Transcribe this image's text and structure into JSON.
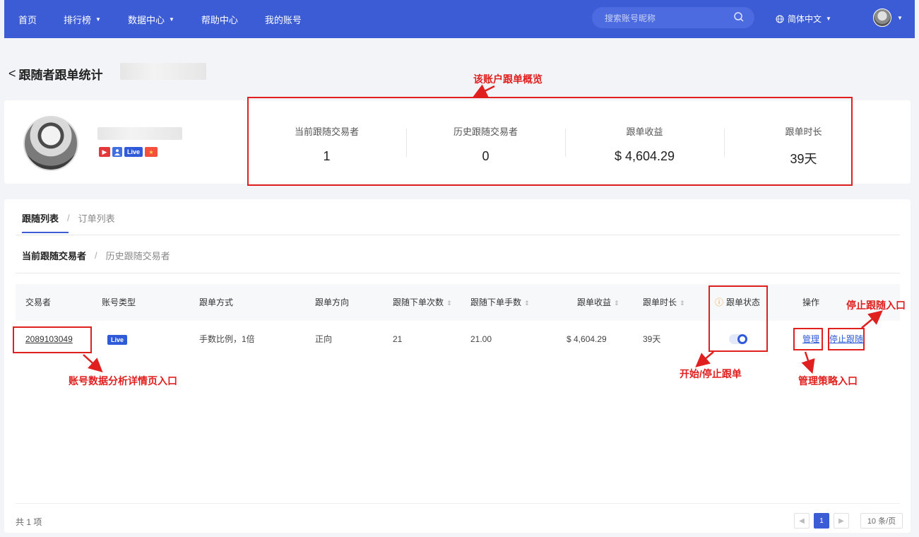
{
  "nav": {
    "items": [
      {
        "label": "首页",
        "caret": ""
      },
      {
        "label": "排行榜",
        "caret": "▼"
      },
      {
        "label": "数据中心",
        "caret": "▼"
      },
      {
        "label": "帮助中心",
        "caret": ""
      },
      {
        "label": "我的账号",
        "caret": ""
      }
    ],
    "search_placeholder": "搜索账号昵称",
    "language": "简体中文",
    "caret": "▼"
  },
  "page": {
    "back_symbol": "<",
    "title": "跟随者跟单统计"
  },
  "profile": {
    "badges": {
      "live": "Live"
    }
  },
  "stats": [
    {
      "label": "当前跟随交易者",
      "value": "1"
    },
    {
      "label": "历史跟随交易者",
      "value": "0"
    },
    {
      "label": "跟单收益",
      "value": "$ 4,604.29"
    },
    {
      "label": "跟单时长",
      "value": "39天"
    }
  ],
  "tabs": {
    "active": "跟随列表",
    "separator": "/",
    "inactive": "订单列表"
  },
  "subtabs": {
    "active": "当前跟随交易者",
    "separator": "/",
    "inactive": "历史跟随交易者"
  },
  "table": {
    "headers": [
      "交易者",
      "账号类型",
      "跟单方式",
      "跟单方向",
      "跟随下单次数",
      "跟随下单手数",
      "跟单收益",
      "跟单时长",
      "跟单状态",
      "操作"
    ],
    "sort_symbol": "⇕",
    "rows": [
      {
        "trader": "2089103049",
        "account_type": "Live",
        "copy_mode": "手数比例，1倍",
        "direction": "正向",
        "order_count": "21",
        "lots": "21.00",
        "profit": "$ 4,604.29",
        "duration": "39天",
        "status_on": true,
        "manage": "管理",
        "stop": "停止跟随"
      }
    ]
  },
  "footer": {
    "total": "共 1 项",
    "current_page": "1",
    "page_size": "10 条/页"
  },
  "annotations": {
    "overview": "该账户跟单概览",
    "detail_entry": "账号数据分析详情页入口",
    "toggle": "开始/停止跟单",
    "manage_entry": "管理策略入口",
    "stop_entry": "停止跟随入口"
  },
  "colors": {
    "primary": "#3c5cd6",
    "annotation": "#e01f1f"
  }
}
